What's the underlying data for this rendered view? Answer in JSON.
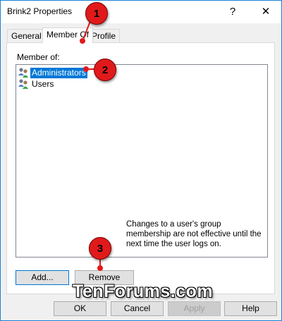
{
  "window": {
    "title": "Brink2 Properties"
  },
  "titlebar": {
    "help_glyph": "?",
    "close_glyph": "✕"
  },
  "tabs": [
    {
      "label": "General",
      "active": false
    },
    {
      "label": "Member Of",
      "active": true
    },
    {
      "label": "Profile",
      "active": false
    }
  ],
  "member_of": {
    "label": "Member of:",
    "items": [
      {
        "name": "Administrators",
        "selected": true
      },
      {
        "name": "Users",
        "selected": false
      }
    ]
  },
  "actions": {
    "add_label": "Add...",
    "remove_label": "Remove"
  },
  "note": "Changes to a user's group membership are not effective until the next time the user logs on.",
  "dialog_buttons": {
    "ok": "OK",
    "cancel": "Cancel",
    "apply": "Apply",
    "help": "Help"
  },
  "callouts": [
    "1",
    "2",
    "3"
  ],
  "watermark": "TenForums.com",
  "colors": {
    "selection": "#0078d7",
    "callout": "#e01a1a",
    "accent": "#1883d7"
  }
}
